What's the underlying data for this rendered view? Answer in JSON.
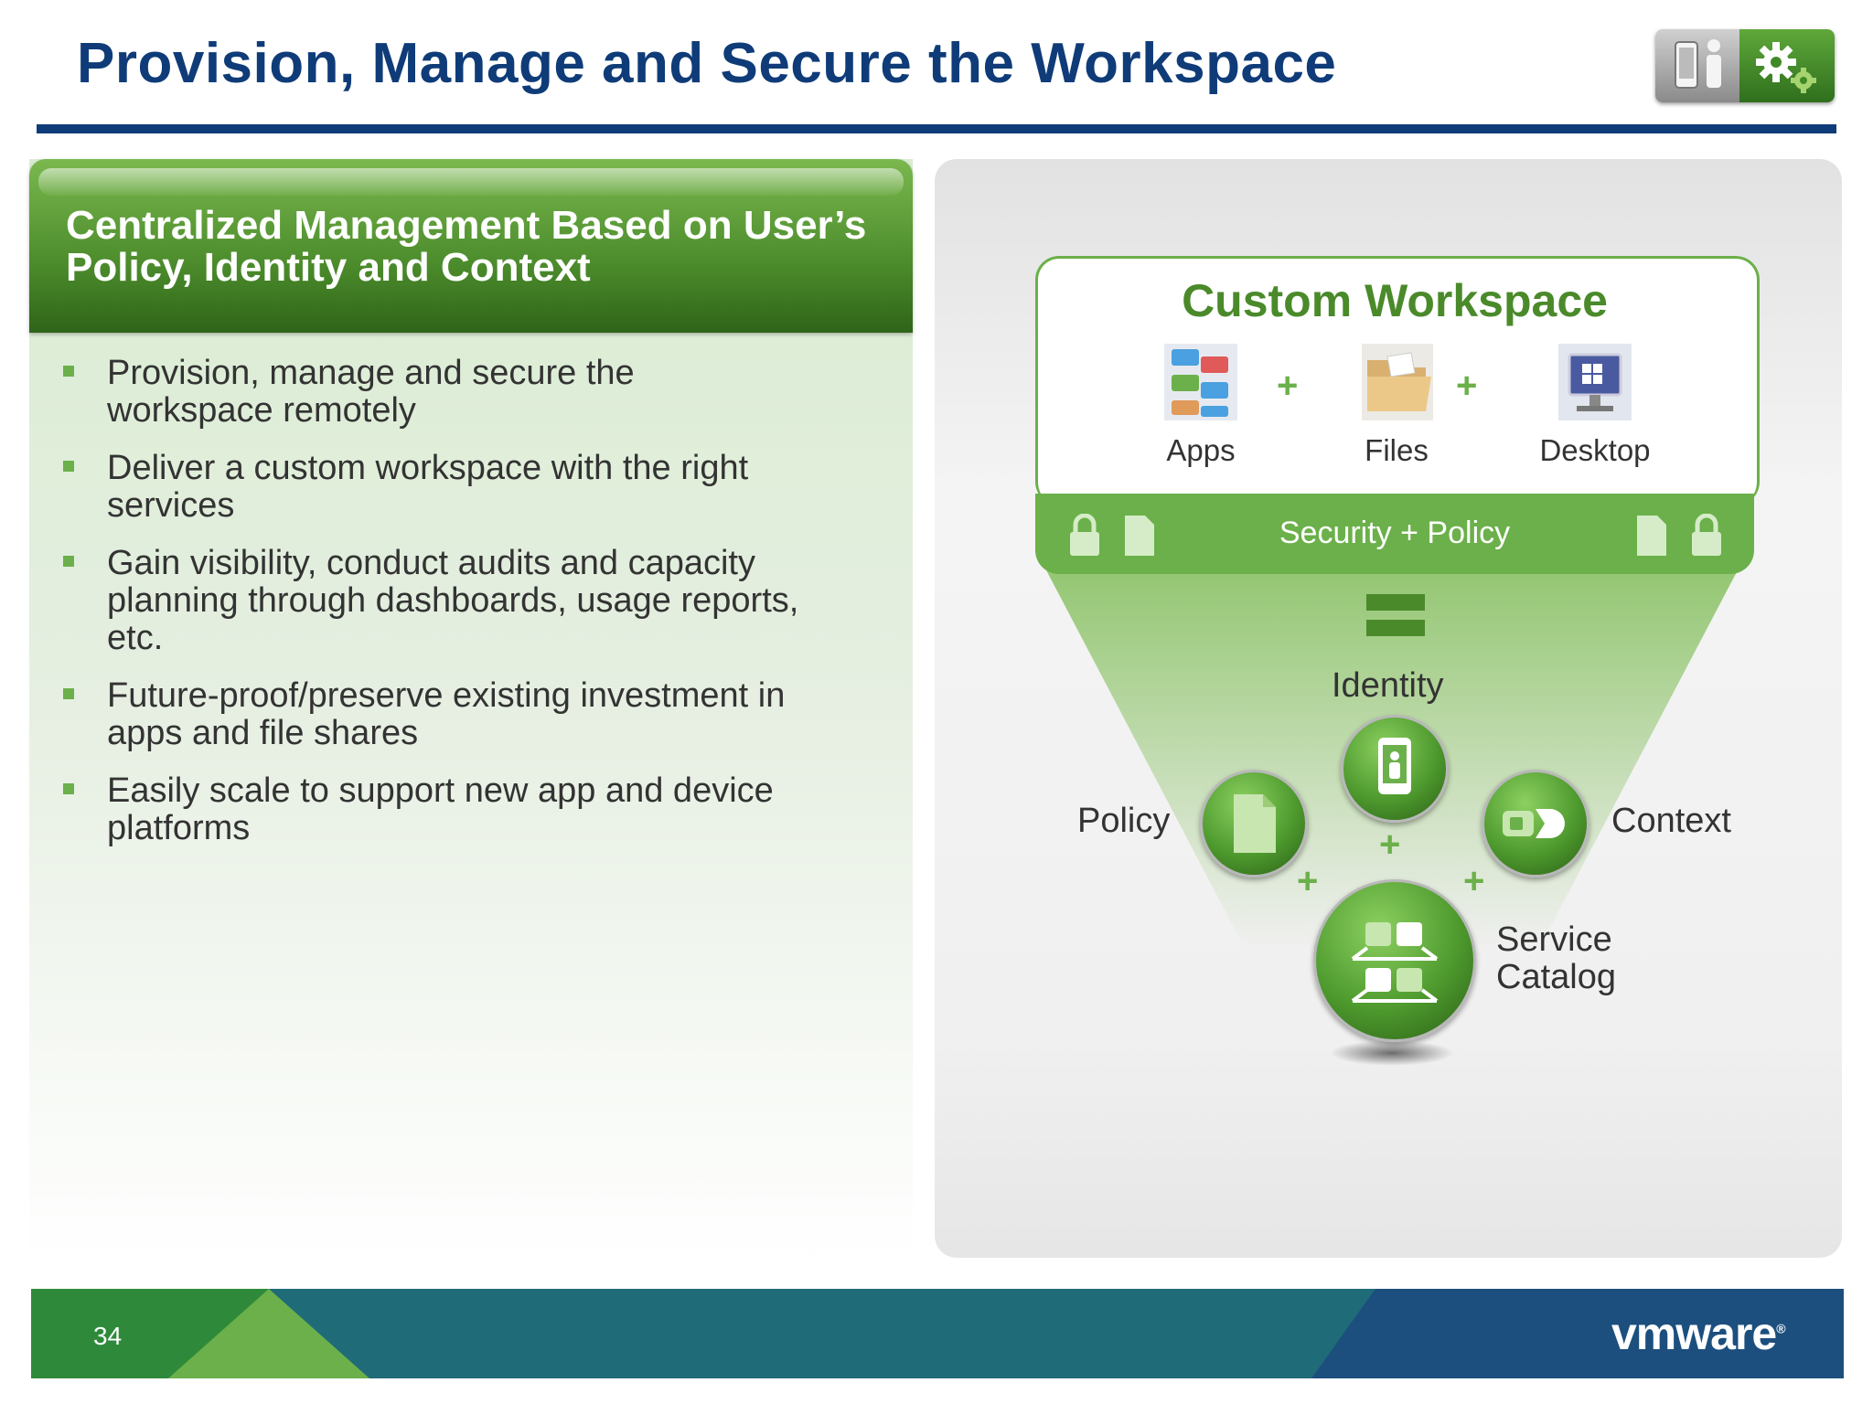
{
  "slide": {
    "title": "Provision, Manage and Secure the Workspace",
    "page_number": "34",
    "logo_text": "vmware"
  },
  "left_panel": {
    "header": "Centralized Management Based on User’s Policy, Identity and Context",
    "bullets": [
      "Provision, manage and secure the workspace remotely",
      "Deliver a custom workspace with the right services",
      "Gain visibility, conduct audits and capacity planning through dashboards, usage reports, etc.",
      "Future-proof/preserve existing investment in apps and file shares",
      "Easily scale to support new app and device platforms"
    ]
  },
  "diagram": {
    "workspace_title": "Custom Workspace",
    "items": [
      {
        "label": "Apps",
        "icon": "apps-icon"
      },
      {
        "label": "Files",
        "icon": "folder-icon"
      },
      {
        "label": "Desktop",
        "icon": "desktop-icon"
      }
    ],
    "plus_sign": "+",
    "security_bar": "Security + Policy",
    "nodes": {
      "identity": "Identity",
      "policy": "Policy",
      "context": "Context",
      "service_catalog_line1": "Service",
      "service_catalog_line2": "Catalog"
    }
  },
  "colors": {
    "title_blue": "#0f3c78",
    "accent_green": "#6bb04a",
    "dark_green": "#4a8a2a",
    "footer_teal": "#1f6b78"
  }
}
